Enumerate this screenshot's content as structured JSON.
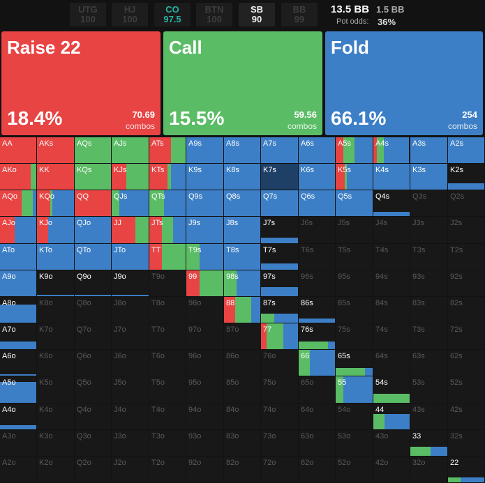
{
  "positions": [
    {
      "name": "UTG",
      "stack": "100",
      "state": "dim"
    },
    {
      "name": "HJ",
      "stack": "100",
      "state": "dim"
    },
    {
      "name": "CO",
      "stack": "97.5",
      "state": "co"
    },
    {
      "name": "BTN",
      "stack": "100",
      "state": "dim"
    },
    {
      "name": "SB",
      "stack": "90",
      "state": "sb"
    },
    {
      "name": "BB",
      "stack": "99",
      "state": "dim"
    }
  ],
  "pot": {
    "main": "13.5 BB",
    "sub": "1.5 BB",
    "odds_label": "Pot odds:",
    "odds_value": "36%"
  },
  "actions": [
    {
      "name": "Raise 22",
      "pct": "18.4%",
      "combos": "70.69",
      "combos_label": "combos",
      "color": "#e84444"
    },
    {
      "name": "Call",
      "pct": "15.5%",
      "combos": "59.56",
      "combos_label": "combos",
      "color": "#5bbc66"
    },
    {
      "name": "Fold",
      "pct": "66.1%",
      "combos": "254",
      "combos_label": "combos",
      "color": "#3d7fc6"
    }
  ],
  "colors": {
    "raise": "#e84444",
    "call": "#5bbc66",
    "fold": "#3d7fc6",
    "empty": "#181818",
    "highlight": "#1e3f66"
  },
  "grid": {
    "rows": [
      [
        {
          "h": "AA",
          "r": 1,
          "c": 0
        },
        {
          "h": "AKs",
          "r": 1,
          "c": 0
        },
        {
          "h": "AQs",
          "r": 0,
          "c": 1
        },
        {
          "h": "AJs",
          "r": 0,
          "c": 1
        },
        {
          "h": "ATs",
          "r": 0.6,
          "c": 0.4
        },
        {
          "h": "A9s",
          "r": 0,
          "c": 0
        },
        {
          "h": "A8s",
          "r": 0,
          "c": 0
        },
        {
          "h": "A7s",
          "r": 0,
          "c": 0
        },
        {
          "h": "A6s",
          "r": 0,
          "c": 0
        },
        {
          "h": "A5s",
          "r": 0.2,
          "c": 0.3
        },
        {
          "h": "A4s",
          "r": 0.1,
          "c": 0.2
        },
        {
          "h": "A3s",
          "r": 0,
          "c": 0
        },
        {
          "h": "A2s",
          "r": 0,
          "c": 0
        }
      ],
      [
        {
          "h": "AKo",
          "r": 0.85,
          "c": 0.15
        },
        {
          "h": "KK",
          "r": 1,
          "c": 0
        },
        {
          "h": "KQs",
          "r": 0,
          "c": 1
        },
        {
          "h": "KJs",
          "r": 0.4,
          "c": 0.6
        },
        {
          "h": "KTs",
          "r": 0.5,
          "c": 0.1
        },
        {
          "h": "K9s",
          "r": 0,
          "c": 0
        },
        {
          "h": "K8s",
          "r": 0,
          "c": 0
        },
        {
          "h": "K7s",
          "r": 0,
          "c": 0,
          "hl": 1
        },
        {
          "h": "K6s",
          "r": 0,
          "c": 0
        },
        {
          "h": "K5s",
          "r": 0.25,
          "c": 0.05
        },
        {
          "h": "K4s",
          "r": 0,
          "c": 0
        },
        {
          "h": "K3s",
          "r": 0,
          "c": 0
        },
        {
          "h": "K2s",
          "f": 0.25
        }
      ],
      [
        {
          "h": "AQo",
          "r": 0.6,
          "c": 0.3
        },
        {
          "h": "KQo",
          "r": 0.35,
          "c": 0.05
        },
        {
          "h": "QQ",
          "r": 1,
          "c": 0
        },
        {
          "h": "QJs",
          "r": 0,
          "c": 0.2
        },
        {
          "h": "QTs",
          "r": 0,
          "c": 0.4
        },
        {
          "h": "Q9s",
          "r": 0,
          "c": 0
        },
        {
          "h": "Q8s",
          "r": 0,
          "c": 0
        },
        {
          "h": "Q7s",
          "r": 0,
          "c": 0
        },
        {
          "h": "Q6s",
          "r": 0,
          "c": 0
        },
        {
          "h": "Q5s",
          "r": 0,
          "c": 0
        },
        {
          "h": "Q4s",
          "f": 0.15
        },
        {
          "h": "Q3s",
          "f": 0
        },
        {
          "h": "Q2s",
          "f": 0
        }
      ],
      [
        {
          "h": "AJo",
          "r": 0.4,
          "c": 0
        },
        {
          "h": "KJo",
          "r": 0.3,
          "c": 0
        },
        {
          "h": "QJo",
          "r": 0,
          "c": 0
        },
        {
          "h": "JJ",
          "r": 0.65,
          "c": 0.35
        },
        {
          "h": "JTs",
          "r": 0.35,
          "c": 0.3
        },
        {
          "h": "J9s",
          "r": 0,
          "c": 0
        },
        {
          "h": "J8s",
          "r": 0,
          "c": 0
        },
        {
          "h": "J7s",
          "f": 0.2
        },
        {
          "h": "J6s",
          "f": 0
        },
        {
          "h": "J5s",
          "f": 0
        },
        {
          "h": "J4s",
          "f": 0
        },
        {
          "h": "J3s",
          "f": 0
        },
        {
          "h": "J2s",
          "f": 0
        }
      ],
      [
        {
          "h": "ATo",
          "r": 0,
          "c": 0
        },
        {
          "h": "KTo",
          "r": 0,
          "c": 0
        },
        {
          "h": "QTo",
          "r": 0,
          "c": 0
        },
        {
          "h": "JTo",
          "r": 0,
          "c": 0
        },
        {
          "h": "TT",
          "r": 0.35,
          "c": 0.65
        },
        {
          "h": "T9s",
          "r": 0,
          "c": 0.35
        },
        {
          "h": "T8s",
          "r": 0,
          "c": 0
        },
        {
          "h": "T7s",
          "f": 0.25
        },
        {
          "h": "T6s",
          "f": 0
        },
        {
          "h": "T5s",
          "f": 0
        },
        {
          "h": "T4s",
          "f": 0
        },
        {
          "h": "T3s",
          "f": 0
        },
        {
          "h": "T2s",
          "f": 0
        }
      ],
      [
        {
          "h": "A9o",
          "r": 0,
          "c": 0
        },
        {
          "h": "K9o",
          "f": 0.05
        },
        {
          "h": "Q9o",
          "f": 0.05
        },
        {
          "h": "J9o",
          "f": 0.05
        },
        {
          "h": "T9o",
          "f": 0
        },
        {
          "h": "99",
          "r": 0.35,
          "c": 0.65
        },
        {
          "h": "98s",
          "r": 0,
          "c": 0.35
        },
        {
          "h": "97s",
          "f": 0.35
        },
        {
          "h": "96s",
          "f": 0
        },
        {
          "h": "95s",
          "f": 0
        },
        {
          "h": "94s",
          "f": 0
        },
        {
          "h": "93s",
          "f": 0
        },
        {
          "h": "92s",
          "f": 0
        }
      ],
      [
        {
          "h": "A8o",
          "f": 0.7
        },
        {
          "h": "K8o",
          "f": 0
        },
        {
          "h": "Q8o",
          "f": 0
        },
        {
          "h": "J8o",
          "f": 0
        },
        {
          "h": "T8o",
          "f": 0
        },
        {
          "h": "98o",
          "f": 0
        },
        {
          "h": "88",
          "r": 0.3,
          "c": 0.45
        },
        {
          "h": "87s",
          "r": 0,
          "c": 0.35,
          "f": 0.35
        },
        {
          "h": "86s",
          "f": 0.15
        },
        {
          "h": "85s",
          "f": 0
        },
        {
          "h": "84s",
          "f": 0
        },
        {
          "h": "83s",
          "f": 0
        },
        {
          "h": "82s",
          "f": 0
        }
      ],
      [
        {
          "h": "A7o",
          "f": 0.3
        },
        {
          "h": "K7o",
          "f": 0
        },
        {
          "h": "Q7o",
          "f": 0
        },
        {
          "h": "J7o",
          "f": 0
        },
        {
          "h": "T7o",
          "f": 0
        },
        {
          "h": "97o",
          "f": 0
        },
        {
          "h": "87o",
          "f": 0
        },
        {
          "h": "77",
          "r": 0.15,
          "c": 0.45
        },
        {
          "h": "76s",
          "r": 0,
          "c": 0.8,
          "f": 0.3
        },
        {
          "h": "75s",
          "f": 0
        },
        {
          "h": "74s",
          "f": 0
        },
        {
          "h": "73s",
          "f": 0
        },
        {
          "h": "72s",
          "f": 0
        }
      ],
      [
        {
          "h": "A6o",
          "f": 0.05
        },
        {
          "h": "K6o",
          "f": 0
        },
        {
          "h": "Q6o",
          "f": 0
        },
        {
          "h": "J6o",
          "f": 0
        },
        {
          "h": "T6o",
          "f": 0
        },
        {
          "h": "96o",
          "f": 0
        },
        {
          "h": "86o",
          "f": 0
        },
        {
          "h": "76o",
          "f": 0
        },
        {
          "h": "66",
          "r": 0,
          "c": 0.3
        },
        {
          "h": "65s",
          "r": 0,
          "c": 0.8,
          "f": 0.3
        },
        {
          "h": "64s",
          "f": 0
        },
        {
          "h": "63s",
          "f": 0
        },
        {
          "h": "62s",
          "f": 0
        }
      ],
      [
        {
          "h": "A5o",
          "f": 0.8
        },
        {
          "h": "K5o",
          "f": 0
        },
        {
          "h": "Q5o",
          "f": 0
        },
        {
          "h": "J5o",
          "f": 0
        },
        {
          "h": "T5o",
          "f": 0
        },
        {
          "h": "95o",
          "f": 0
        },
        {
          "h": "85o",
          "f": 0
        },
        {
          "h": "75o",
          "f": 0
        },
        {
          "h": "65o",
          "f": 0
        },
        {
          "h": "55",
          "r": 0,
          "c": 0.2
        },
        {
          "h": "54s",
          "r": 0,
          "c": 1,
          "f": 0.35
        },
        {
          "h": "53s",
          "f": 0
        },
        {
          "h": "52s",
          "f": 0
        }
      ],
      [
        {
          "h": "A4o",
          "f": 0.15
        },
        {
          "h": "K4o",
          "f": 0
        },
        {
          "h": "Q4o",
          "f": 0
        },
        {
          "h": "J4o",
          "f": 0
        },
        {
          "h": "T4o",
          "f": 0
        },
        {
          "h": "94o",
          "f": 0
        },
        {
          "h": "84o",
          "f": 0
        },
        {
          "h": "74o",
          "f": 0
        },
        {
          "h": "64o",
          "f": 0
        },
        {
          "h": "54o",
          "f": 0
        },
        {
          "h": "44",
          "r": 0,
          "c": 0.3,
          "f": 0.6
        },
        {
          "h": "43s",
          "f": 0
        },
        {
          "h": "42s",
          "f": 0
        }
      ],
      [
        {
          "h": "A3o",
          "f": 0
        },
        {
          "h": "K3o",
          "f": 0
        },
        {
          "h": "Q3o",
          "f": 0
        },
        {
          "h": "J3o",
          "f": 0
        },
        {
          "h": "T3o",
          "f": 0
        },
        {
          "h": "93o",
          "f": 0
        },
        {
          "h": "83o",
          "f": 0
        },
        {
          "h": "73o",
          "f": 0
        },
        {
          "h": "63o",
          "f": 0
        },
        {
          "h": "53o",
          "f": 0
        },
        {
          "h": "43o",
          "f": 0
        },
        {
          "h": "33",
          "r": 0,
          "c": 0.55,
          "f": 0.35
        },
        {
          "h": "32s",
          "f": 0
        }
      ],
      [
        {
          "h": "A2o",
          "f": 0
        },
        {
          "h": "K2o",
          "f": 0
        },
        {
          "h": "Q2o",
          "f": 0
        },
        {
          "h": "J2o",
          "f": 0
        },
        {
          "h": "T2o",
          "f": 0
        },
        {
          "h": "92o",
          "f": 0
        },
        {
          "h": "82o",
          "f": 0
        },
        {
          "h": "72o",
          "f": 0
        },
        {
          "h": "62o",
          "f": 0
        },
        {
          "h": "52o",
          "f": 0
        },
        {
          "h": "42o",
          "f": 0
        },
        {
          "h": "32o",
          "f": 0
        },
        {
          "h": "22",
          "r": 0,
          "c": 0.35,
          "f": 0.2
        }
      ]
    ]
  }
}
